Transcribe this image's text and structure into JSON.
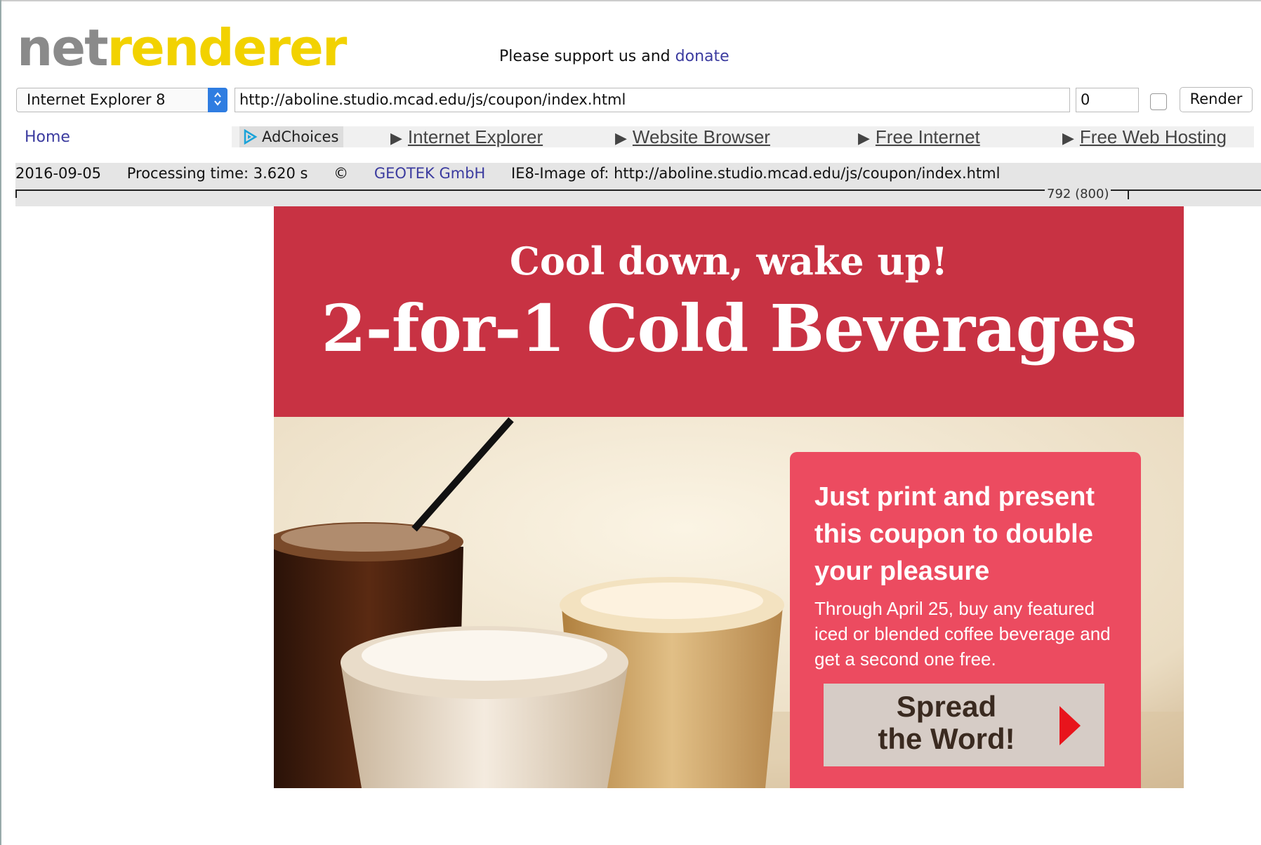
{
  "logo": {
    "part1": "net",
    "part2": "renderer"
  },
  "support": {
    "text": "Please support us and ",
    "donate_label": "donate"
  },
  "toolbar": {
    "browser_select_value": "Internet Explorer 8",
    "url_value": "http://aboline.studio.mcad.edu/js/coupon/index.html",
    "number_value": "0",
    "render_label": "Render"
  },
  "nav": {
    "home_label": "Home",
    "adchoices_label": "AdChoices",
    "ad_links": [
      "Internet Explorer",
      "Website Browser",
      "Free Internet",
      "Free Web Hosting"
    ]
  },
  "info": {
    "date": "2016-09-05",
    "processing": "Processing time: 3.620 s",
    "copyright_symbol": "©",
    "company": "GEOTEK GmbH",
    "image_of": "IE8-Image of: http://aboline.studio.mcad.edu/js/coupon/index.html",
    "ruler_label": "792 (800)"
  },
  "coupon": {
    "subtitle": "Cool down, wake up!",
    "title": "2-for-1 Cold Beverages",
    "promo_heading": "Just print and present this coupon to double your pleasure",
    "promo_body": "Through April 25, buy any featured iced or blended coffee beverage and get a second one free.",
    "spread_label_line1": "Spread",
    "spread_label_line2": "the Word!"
  },
  "colors": {
    "logo_gray": "#8a8a8a",
    "logo_yellow": "#f2d200",
    "link_blue": "#3b3b9f",
    "coupon_red": "#c83243",
    "promo_pink": "#ec4b60",
    "select_blue": "#2f7de1"
  },
  "icons": [
    "adchoices-icon",
    "select-arrows-icon",
    "triangle-right-icon",
    "red-arrow-icon"
  ]
}
